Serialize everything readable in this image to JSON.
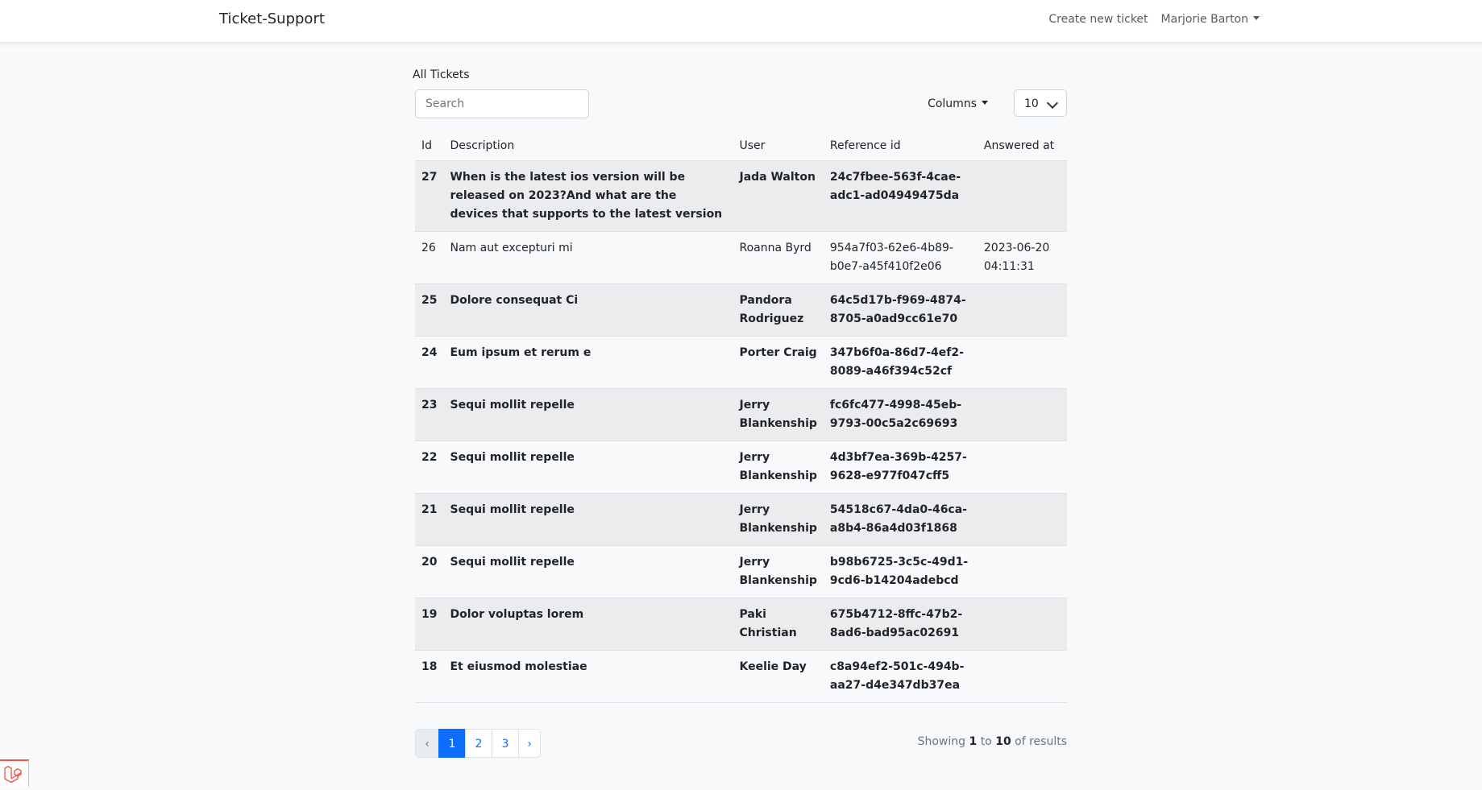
{
  "navbar": {
    "brand": "Ticket-Support",
    "create_link": "Create new ticket",
    "user_menu": "Marjorie Barton"
  },
  "main": {
    "title": "All Tickets",
    "search_placeholder": "Search",
    "columns_label": "Columns",
    "per_page": "10"
  },
  "table": {
    "headers": {
      "id": "Id",
      "description": "Description",
      "user": "User",
      "reference": "Reference id",
      "answered": "Answered at"
    },
    "rows": [
      {
        "id": "27",
        "description": "When is the latest ios version will be released on 2023?And what are the devices that supports to the latest version",
        "user": "Jada Walton",
        "reference": "24c7fbee-563f-4cae-adc1-ad04949475da",
        "answered": ""
      },
      {
        "id": "26",
        "description": "Nam aut excepturi mi",
        "user": "Roanna Byrd",
        "reference": "954a7f03-62e6-4b89-b0e7-a45f410f2e06",
        "answered": "2023-06-20 04:11:31"
      },
      {
        "id": "25",
        "description": "Dolore consequat Ci",
        "user": "Pandora Rodriguez",
        "reference": "64c5d17b-f969-4874-8705-a0ad9cc61e70",
        "answered": ""
      },
      {
        "id": "24",
        "description": "Eum ipsum et rerum e",
        "user": "Porter Craig",
        "reference": "347b6f0a-86d7-4ef2-8089-a46f394c52cf",
        "answered": ""
      },
      {
        "id": "23",
        "description": "Sequi mollit repelle",
        "user": "Jerry Blankenship",
        "reference": "fc6fc477-4998-45eb-9793-00c5a2c69693",
        "answered": ""
      },
      {
        "id": "22",
        "description": "Sequi mollit repelle",
        "user": "Jerry Blankenship",
        "reference": "4d3bf7ea-369b-4257-9628-e977f047cff5",
        "answered": ""
      },
      {
        "id": "21",
        "description": "Sequi mollit repelle",
        "user": "Jerry Blankenship",
        "reference": "54518c67-4da0-46ca-a8b4-86a4d03f1868",
        "answered": ""
      },
      {
        "id": "20",
        "description": "Sequi mollit repelle",
        "user": "Jerry Blankenship",
        "reference": "b98b6725-3c5c-49d1-9cd6-b14204adebcd",
        "answered": ""
      },
      {
        "id": "19",
        "description": "Dolor voluptas lorem",
        "user": "Paki Christian",
        "reference": "675b4712-8ffc-47b2-8ad6-bad95ac02691",
        "answered": ""
      },
      {
        "id": "18",
        "description": "Et eiusmod molestiae",
        "user": "Keelie Day",
        "reference": "c8a94ef2-501c-494b-aa27-d4e347db37ea",
        "answered": ""
      }
    ]
  },
  "pagination": {
    "prev": "‹",
    "pages": [
      "1",
      "2",
      "3"
    ],
    "next": "›",
    "showing_prefix": "Showing",
    "from": "1",
    "to_word": "to",
    "to": "10",
    "of_results": "of results"
  },
  "colors": {
    "primary": "#0d6efd",
    "stripe": "#ebecee",
    "laravel_red": "#f05340"
  },
  "icons": {
    "laravel": "laravel-logo-icon"
  }
}
